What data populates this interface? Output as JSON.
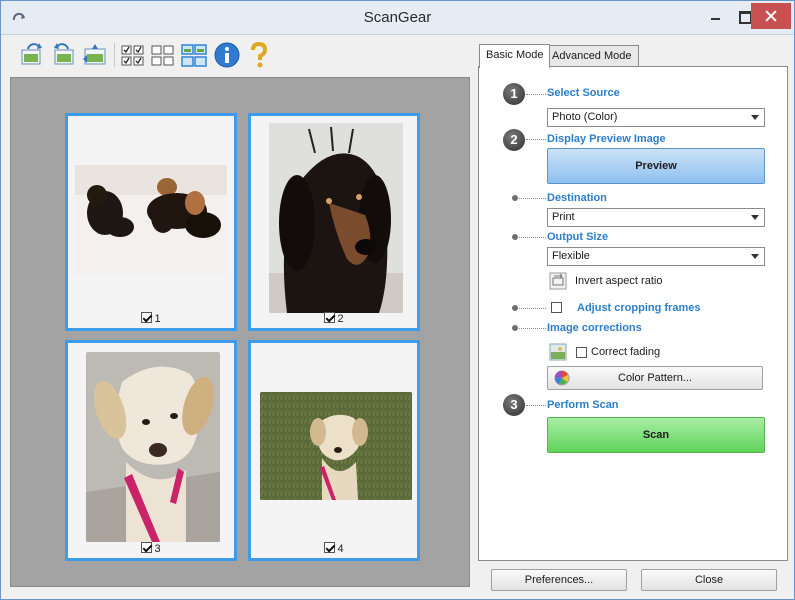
{
  "window": {
    "title": "ScanGear"
  },
  "toolbar": {
    "icons": [
      "rotate-left-icon",
      "rotate-right-icon",
      "auto-crop-icon",
      "select-all-frames-icon",
      "deselect-all-frames-icon",
      "multi-crop-view-icon",
      "info-icon",
      "help-icon"
    ]
  },
  "thumbnails": [
    {
      "number": "1",
      "checked": true
    },
    {
      "number": "2",
      "checked": true
    },
    {
      "number": "3",
      "checked": true
    },
    {
      "number": "4",
      "checked": true
    }
  ],
  "tabs": {
    "basic": "Basic Mode",
    "advanced": "Advanced Mode"
  },
  "steps": {
    "s1": "1",
    "s2": "2",
    "s3": "3"
  },
  "basic_mode": {
    "select_source_label": "Select Source",
    "select_source_value": "Photo (Color)",
    "display_preview_label": "Display Preview Image",
    "preview_button": "Preview",
    "destination_label": "Destination",
    "destination_value": "Print",
    "output_size_label": "Output Size",
    "output_size_value": "Flexible",
    "invert_aspect_label": "Invert aspect ratio",
    "adjust_cropping_label": "Adjust cropping frames",
    "image_corrections_label": "Image corrections",
    "correct_fading_label": "Correct fading",
    "color_pattern_button": "Color Pattern...",
    "perform_scan_label": "Perform Scan",
    "scan_button": "Scan"
  },
  "footer": {
    "preferences_button": "Preferences...",
    "close_button": "Close"
  },
  "colors": {
    "accent_blue": "#2d7ec9",
    "thumb_border": "#3d9be9",
    "scan_green": "#5fd35a",
    "preview_blue": "#8fc1ef"
  }
}
